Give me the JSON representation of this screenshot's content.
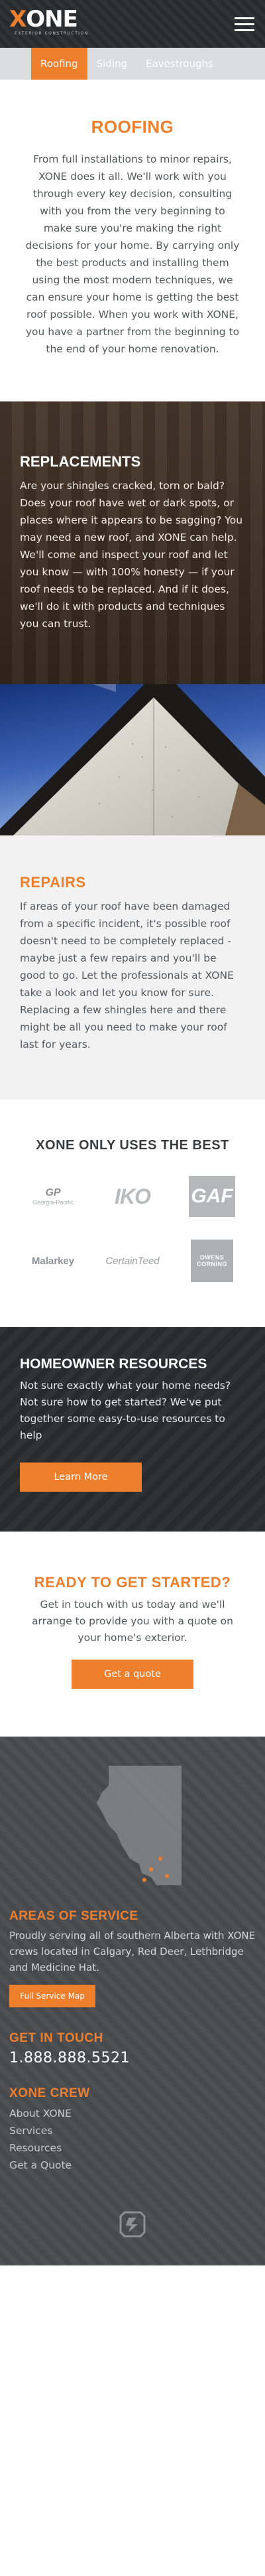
{
  "header": {
    "logo_x": "X",
    "logo_rest": "ONE",
    "logo_tagline": "EXTERIOR CONSTRUCTION"
  },
  "subnav": {
    "items": [
      {
        "label": "Roofing"
      },
      {
        "label": "Siding"
      },
      {
        "label": "Eavestroughs"
      }
    ]
  },
  "intro": {
    "title": "ROOFING",
    "body": "From full installations to minor repairs, XONE does it all. We'll work with you through every key decision, consulting with you from the very beginning to make sure you're making the right decisions for your home. By carrying only the best products and installing them using the most modern techniques, we can ensure your home is getting the best roof possible. When you work with XONE, you have a partner from the beginning to the end of your home renovation."
  },
  "replacements": {
    "title": "REPLACEMENTS",
    "body": "Are your shingles cracked, torn or bald? Does your roof have wet or dark spots, or places where it appears to be sagging? You may need a new roof, and XONE can help. We'll come and inspect your roof and let you know — with 100% honesty — if your roof needs to be replaced. And if it does, we'll do it with products and techniques you can trust."
  },
  "repairs": {
    "title": "REPAIRS",
    "body": "If areas of your roof have been damaged from a specific incident, it's possible roof doesn't need to be completely replaced - maybe just a few repairs and you'll be good to go. Let the professionals at XONE take a look and let you know for sure. Replacing a few shingles here and there might be all you need to make your roof last for years."
  },
  "brands": {
    "title": "XONE ONLY USES THE BEST",
    "logos": [
      {
        "name": "GP",
        "sub": "Georgia-Pacific"
      },
      {
        "name": "IKO"
      },
      {
        "name": "GAF"
      },
      {
        "name": "Malarkey"
      },
      {
        "name": "CertainTeed"
      },
      {
        "name": "OWENS CORNING"
      }
    ]
  },
  "resources": {
    "title": "HOMEOWNER RESOURCES",
    "body": "Not sure exactly what your home needs? Not sure how to get started? We've put together some easy-to-use resources to help",
    "button": "Learn More"
  },
  "ready": {
    "title": "READY TO GET STARTED?",
    "body": "Get in touch with us today and we'll arrange to provide you with a quote on your home's exterior.",
    "button": "Get a quote"
  },
  "footer": {
    "service_title": "AREAS OF SERVICE",
    "service_body": "Proudly serving all of southern Alberta with XONE crews located in Calgary, Red Deer, Lethbridge and Medicine Hat.",
    "map_button": "Full Service Map",
    "touch_title": "GET IN TOUCH",
    "phone": "1.888.888.5521",
    "crew_title": "XONE CREW",
    "crew_links": [
      {
        "label": "About XONE"
      },
      {
        "label": "Services"
      },
      {
        "label": "Resources"
      },
      {
        "label": "Get a Quote"
      }
    ]
  },
  "colors": {
    "accent": "#ee7f2d",
    "dark": "#2b2d30",
    "footer": "#4b4d51"
  }
}
